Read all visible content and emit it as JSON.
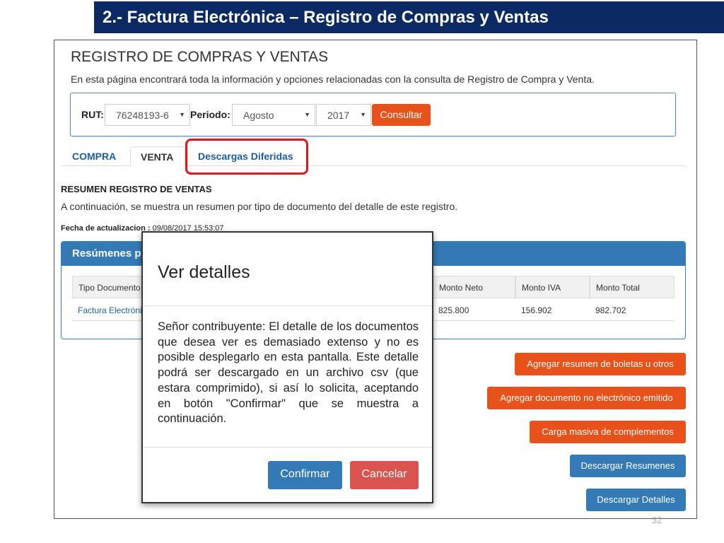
{
  "slide": {
    "title": "2.- Factura Electrónica – Registro de Compras y Ventas",
    "page_number": "32"
  },
  "page": {
    "title": "REGISTRO DE COMPRAS Y VENTAS",
    "intro": "En esta página encontrará toda la información y opciones relacionadas con la consulta de Registro de Compra y Venta."
  },
  "filters": {
    "rut_label": "RUT:",
    "rut_value": "76248193-6",
    "periodo_label": "Periodo:",
    "month_value": "Agosto",
    "year_value": "2017",
    "consult_button": "Consultar"
  },
  "tabs": [
    {
      "label": "COMPRA",
      "active": false
    },
    {
      "label": "VENTA",
      "active": true
    },
    {
      "label": "Descargas Diferidas",
      "active": false
    }
  ],
  "summary": {
    "title": "RESUMEN REGISTRO DE VENTAS",
    "intro": "A continuación, se muestra un resumen por tipo de documento del detalle de este registro.",
    "update_label": "Fecha de actualizacion :",
    "update_value": "09/08/2017 15:53:07",
    "panel_title": "Resúmenes p",
    "columns": [
      "Tipo Documento",
      "Monto Neto",
      "Monto IVA",
      "Monto Total"
    ],
    "rows": [
      {
        "tipo": "Factura Electrónica",
        "neto": "825.800",
        "iva": "156.902",
        "total": "982.702"
      }
    ]
  },
  "actions": {
    "agregar_resumen": "Agregar resumen de boletas u otros",
    "agregar_documento": "Agregar documento no electrónico emitido",
    "carga_masiva": "Carga masiva de complementos",
    "descargar_resumenes": "Descargar Resumenes",
    "descargar_detalles": "Descargar Detalles"
  },
  "modal": {
    "title": "Ver detalles",
    "body": "Señor contribuyente: El detalle de los documentos que desea ver es demasiado extenso y no es posible desplegarlo en esta pantalla. Este detalle podrá ser descargado en un archivo csv (que estara comprimido), si así lo solicita, aceptando en botón \"Confirmar\" que se muestra a continuación.",
    "confirm": "Confirmar",
    "cancel": "Cancelar"
  },
  "colors": {
    "header_navy": "#0b2a63",
    "accent_orange": "#e8521a",
    "primary_blue": "#337ab7",
    "danger_red": "#d9534f",
    "highlight_red": "#e8131d"
  }
}
